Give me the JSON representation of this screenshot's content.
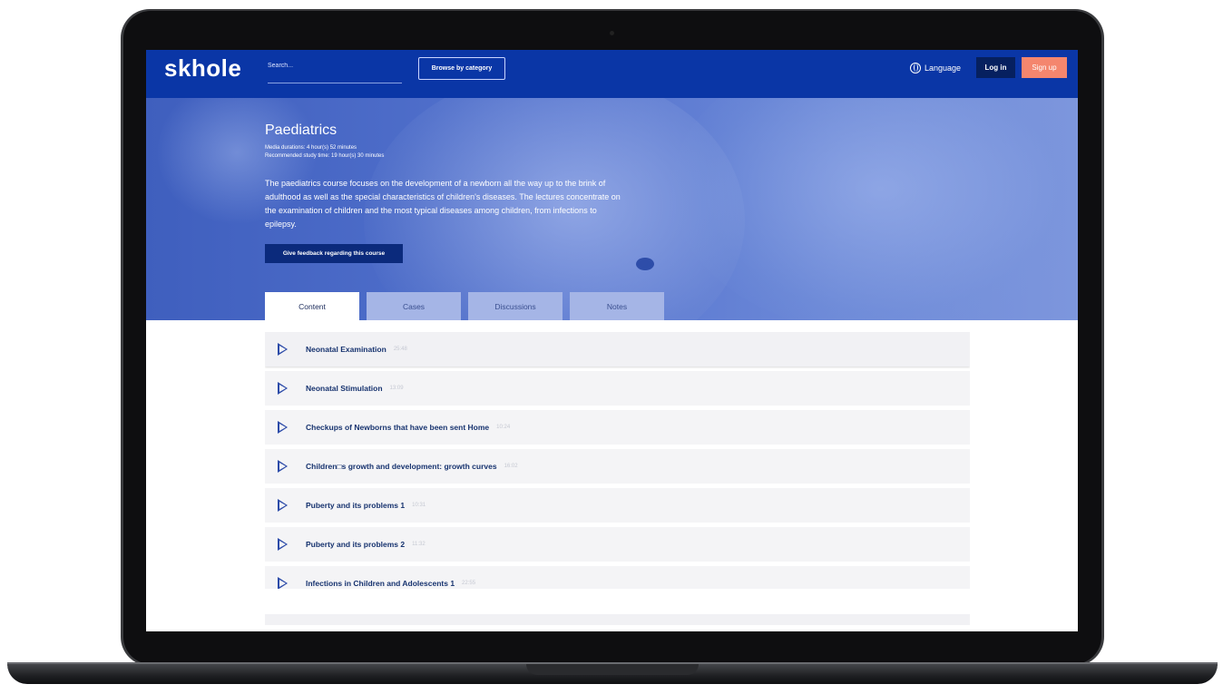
{
  "nav": {
    "logo": "skhole",
    "search_placeholder": "Search...",
    "browse_label": "Browse by category",
    "language_label": "Language",
    "login_label": "Log in",
    "signup_label": "Sign up"
  },
  "course": {
    "title": "Paediatrics",
    "media_duration": "Media durations: 4 hour(s) 52 minutes",
    "study_time": "Recommended study time: 19 hour(s) 30 minutes",
    "description": "The paediatrics course focuses on the development of a newborn all the way up to the brink of adulthood as well as the special characteristics of children's diseases. The lectures concentrate on the examination of children and the most typical diseases among children, from infections to epilepsy.",
    "feedback_label": "Give feedback regarding this course"
  },
  "tabs": [
    {
      "label": "Content",
      "active": true
    },
    {
      "label": "Cases",
      "active": false
    },
    {
      "label": "Discussions",
      "active": false
    },
    {
      "label": "Notes",
      "active": false
    }
  ],
  "lessons": [
    {
      "title": "Neonatal Examination",
      "duration": "25:48"
    },
    {
      "title": "Neonatal Stimulation",
      "duration": "13:09"
    },
    {
      "title": "Checkups of Newborns that have been sent Home",
      "duration": "10:24"
    },
    {
      "title": "Children□s growth and development: growth curves",
      "duration": "16:02"
    },
    {
      "title": "Puberty and its problems 1",
      "duration": "10:31"
    },
    {
      "title": "Puberty and its problems 2",
      "duration": "11:32"
    },
    {
      "title": "Infections in Children and Adolescents 1",
      "duration": "22:55"
    }
  ],
  "colors": {
    "nav_bg": "#0a36a6",
    "signup_bg": "#f4866e",
    "login_bg": "#06205f",
    "lesson_text": "#17336f"
  }
}
